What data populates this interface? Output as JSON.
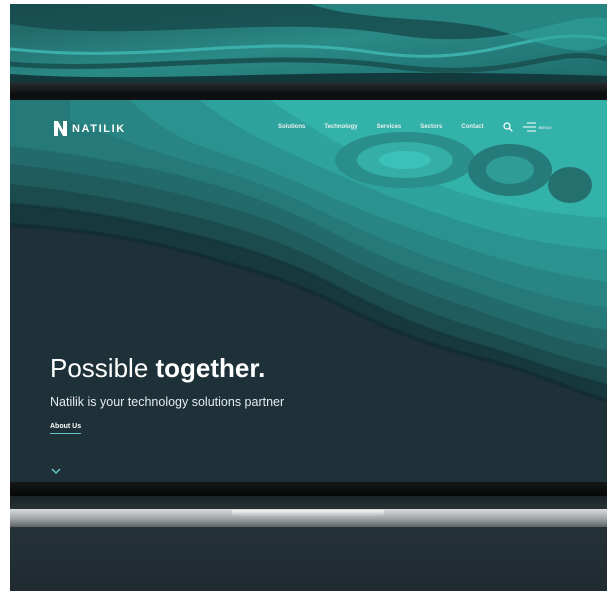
{
  "brand": {
    "name": "NATILIK",
    "accent_color": "#5fc7c6",
    "background_color": "#1e3038"
  },
  "nav": {
    "links": [
      "Solutions",
      "Technology",
      "Services",
      "Sectors",
      "Contact"
    ],
    "search_icon": "search-icon",
    "menu_label": "MENU",
    "menu_icon": "hamburger-icon"
  },
  "hero": {
    "title_regular": "Possible ",
    "title_bold": "together.",
    "subtitle": "Natilik is your technology solutions partner",
    "cta": "About Us",
    "scroll_icon": "chevron-down-icon"
  }
}
